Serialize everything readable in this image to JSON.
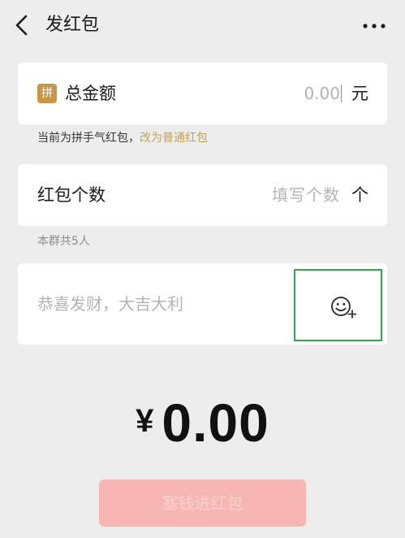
{
  "header": {
    "title": "发红包",
    "back_icon": "chevron-left-icon",
    "more_icon": "more-dots-icon"
  },
  "amount": {
    "badge": "拼",
    "label": "总金额",
    "placeholder": "0.00",
    "unit": "元"
  },
  "mode_tip": {
    "current": "当前为拼手气红包",
    "separator": "，",
    "switch_link": "改为普通红包"
  },
  "count": {
    "label": "红包个数",
    "placeholder": "填写个数",
    "unit": "个"
  },
  "members_tip": "本群共5人",
  "greeting": {
    "placeholder": "恭喜发财，大吉大利",
    "emoji_icon": "emoji-add-icon"
  },
  "total": {
    "currency": "¥",
    "amount": "0.00"
  },
  "submit_label": "塞钱进红包",
  "colors": {
    "background": "#ededed",
    "accent_gold": "#c9a24a",
    "badge_gold": "#c89646",
    "submit_disabled": "#f6b7b4",
    "highlight_green": "#2ea84f"
  }
}
